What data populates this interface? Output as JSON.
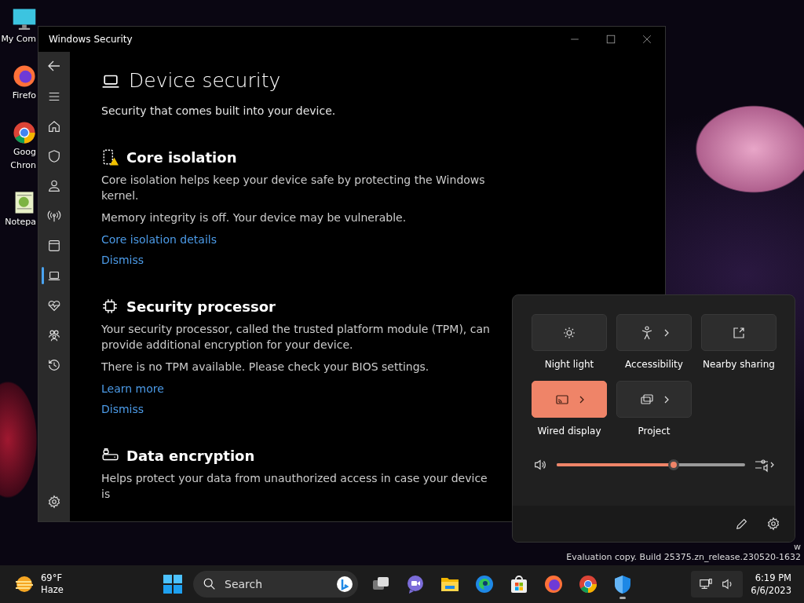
{
  "desktop_icons": [
    {
      "kind": "computer",
      "lines": [
        "My Com"
      ]
    },
    {
      "kind": "firefox",
      "lines": [
        "Firefo"
      ]
    },
    {
      "kind": "chrome",
      "lines": [
        "Goog",
        "Chron"
      ]
    },
    {
      "kind": "notepad",
      "lines": [
        "Notepa"
      ]
    }
  ],
  "window": {
    "title": "Windows Security",
    "nav": [
      {
        "kind": "back",
        "selected": false
      },
      {
        "kind": "menu",
        "selected": false
      },
      {
        "kind": "home",
        "selected": false
      },
      {
        "kind": "shield",
        "selected": false
      },
      {
        "kind": "person",
        "selected": false
      },
      {
        "kind": "antenna",
        "selected": false
      },
      {
        "kind": "browser",
        "selected": false
      },
      {
        "kind": "laptop",
        "selected": true
      },
      {
        "kind": "heart",
        "selected": false
      },
      {
        "kind": "family",
        "selected": false
      },
      {
        "kind": "history",
        "selected": false
      }
    ],
    "page": {
      "title": "Device security",
      "subtitle": "Security that comes built into your device.",
      "sections": [
        {
          "kind": "core",
          "title": "Core isolation",
          "paragraphs": [
            "Core isolation helps keep your device safe by protecting the Windows kernel.",
            "Memory integrity is off. Your device may be vulnerable."
          ],
          "links": [
            "Core isolation details",
            "Dismiss"
          ]
        },
        {
          "kind": "chip",
          "title": "Security processor",
          "paragraphs": [
            "Your security processor, called the trusted platform module (TPM), can provide additional encryption for your device.",
            "There is no TPM available. Please check your BIOS settings."
          ],
          "links": [
            "Learn more",
            "Dismiss"
          ]
        },
        {
          "kind": "lock",
          "title": "Data encryption",
          "paragraphs": [
            "Helps protect your data from unauthorized access in case your device is"
          ]
        }
      ]
    }
  },
  "desktop_notice": [
    "w",
    "Evaluation copy. Build 25375.zn_release.230520-1632"
  ],
  "quick_settings": {
    "tiles": [
      {
        "kind": "night",
        "label": "Night light",
        "on": false,
        "chevron": false
      },
      {
        "kind": "access",
        "label": "Accessibility",
        "on": false,
        "chevron": true
      },
      {
        "kind": "share",
        "label": "Nearby sharing",
        "on": false,
        "chevron": false
      },
      {
        "kind": "cast",
        "label": "Wired display",
        "on": true,
        "chevron": true
      },
      {
        "kind": "project",
        "label": "Project",
        "on": false,
        "chevron": true
      }
    ],
    "volume": {
      "level": 0.62
    }
  },
  "taskbar": {
    "weather": {
      "temperature": "69°F",
      "condition": "Haze"
    },
    "search": {
      "placeholder": "Search"
    },
    "apps": [
      {
        "kind": "taskview",
        "active": false
      },
      {
        "kind": "meet",
        "active": false
      },
      {
        "kind": "explorer",
        "active": false
      },
      {
        "kind": "edge",
        "active": false
      },
      {
        "kind": "store",
        "active": false
      },
      {
        "kind": "firefox",
        "active": false
      },
      {
        "kind": "chrome",
        "active": false
      },
      {
        "kind": "security",
        "active": true
      }
    ],
    "clock": {
      "time": "6:19 PM",
      "date": "6/6/2023"
    }
  }
}
